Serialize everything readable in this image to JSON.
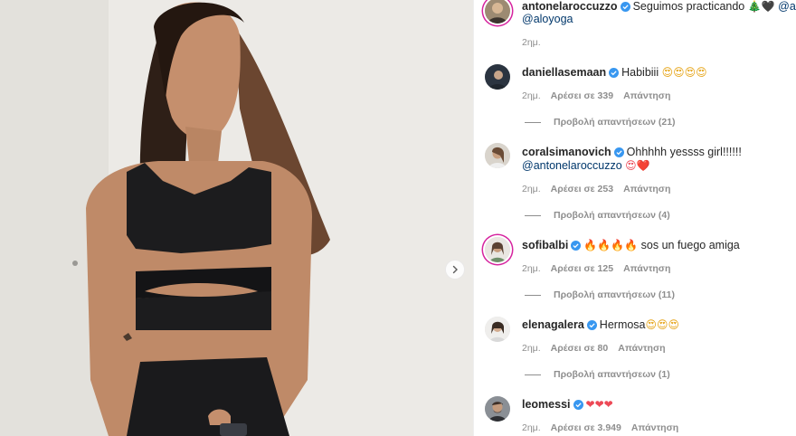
{
  "media": {
    "next_icon": "chevron-right-icon"
  },
  "caption": {
    "username": "antonelaroccuzzo",
    "text": "Seguimos practicando",
    "emojis": "🎄🖤",
    "mention_1": "@alo",
    "mention_2": "@aloyoga",
    "time": "2ημ."
  },
  "comments": [
    {
      "username": "daniellasemaan",
      "text": "Habibiii",
      "emojis": "😍😍😍😍",
      "time": "2ημ.",
      "likes": "Αρέσει σε 339",
      "reply": "Απάντηση",
      "view_replies": "Προβολή απαντήσεων (21)"
    },
    {
      "username": "coralsimanovich",
      "text": "Ohhhhh yessss girl!!!!!!",
      "mention": "@antonelaroccuzzo",
      "emojis": "😍❤️",
      "time": "2ημ.",
      "likes": "Αρέσει σε 253",
      "reply": "Απάντηση",
      "view_replies": "Προβολή απαντήσεων (4)"
    },
    {
      "username": "sofibalbi",
      "emojis": "🔥🔥🔥🔥",
      "text": "sos un fuego amiga",
      "time": "2ημ.",
      "likes": "Αρέσει σε 125",
      "reply": "Απάντηση",
      "view_replies": "Προβολή απαντήσεων (11)"
    },
    {
      "username": "elenagalera",
      "text": "Hermosa",
      "emojis": "😍😍😍",
      "time": "2ημ.",
      "likes": "Αρέσει σε 80",
      "reply": "Απάντηση",
      "view_replies": "Προβολή απαντήσεων (1)"
    },
    {
      "username": "leomessi",
      "emojis": "❤❤❤",
      "time": "2ημ.",
      "likes": "Αρέσει σε 3.949",
      "reply": "Απάντηση"
    }
  ],
  "colors": {
    "verified": "#3897f0",
    "link": "#00376b",
    "secondary": "#8e8e8e",
    "story_ring": "#d6249f"
  }
}
